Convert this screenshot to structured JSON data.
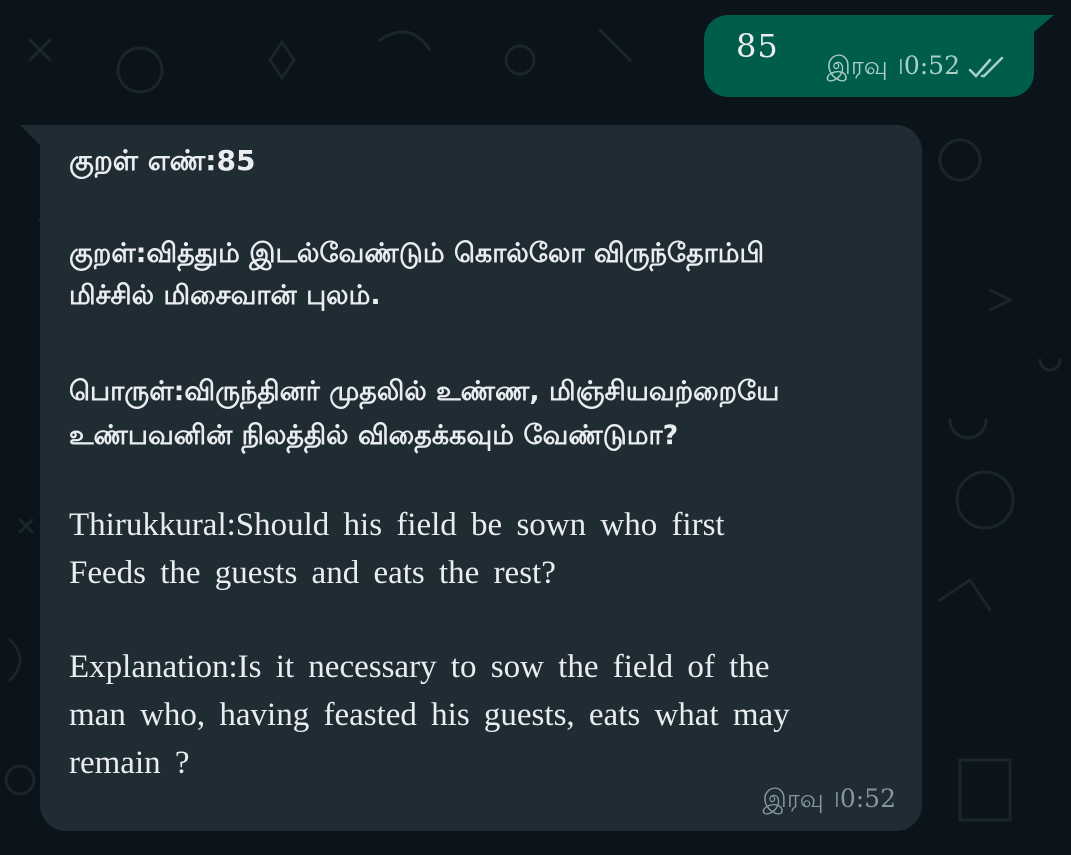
{
  "outgoing": {
    "text": "85",
    "time": "இரவு ।0:52",
    "status_icon": "double-check-icon"
  },
  "incoming": {
    "title": "குறள் எண்:85",
    "kural_line1": "குறள்:வித்தும் இடல்வேண்டும் கொல்லோ விருந்தோம்பி",
    "kural_line2": "மிச்சில் மிசைவான் புலம்.",
    "meaning_line1": "பொருள்:விருந்தினர் முதலில் உண்ண, மிஞ்சியவற்றையே",
    "meaning_line2": "உண்பவனின் நிலத்தில் விதைக்கவும் வேண்டுமா?",
    "thirukkural_line1": "Thirukkural:Should his field be sown who first",
    "thirukkural_line2": "Feeds the guests and eats the rest?",
    "explanation_line1": "Explanation:Is it necessary to sow the field of the",
    "explanation_line2": "man who, having feasted his guests, eats what may",
    "explanation_line3": "remain ?",
    "time": "இரவு ।0:52"
  },
  "colors": {
    "background": "#0b141a",
    "outgoing_bubble": "#005c4b",
    "incoming_bubble": "#202c33",
    "text": "#e9edef",
    "meta_text": "#8696a0"
  }
}
